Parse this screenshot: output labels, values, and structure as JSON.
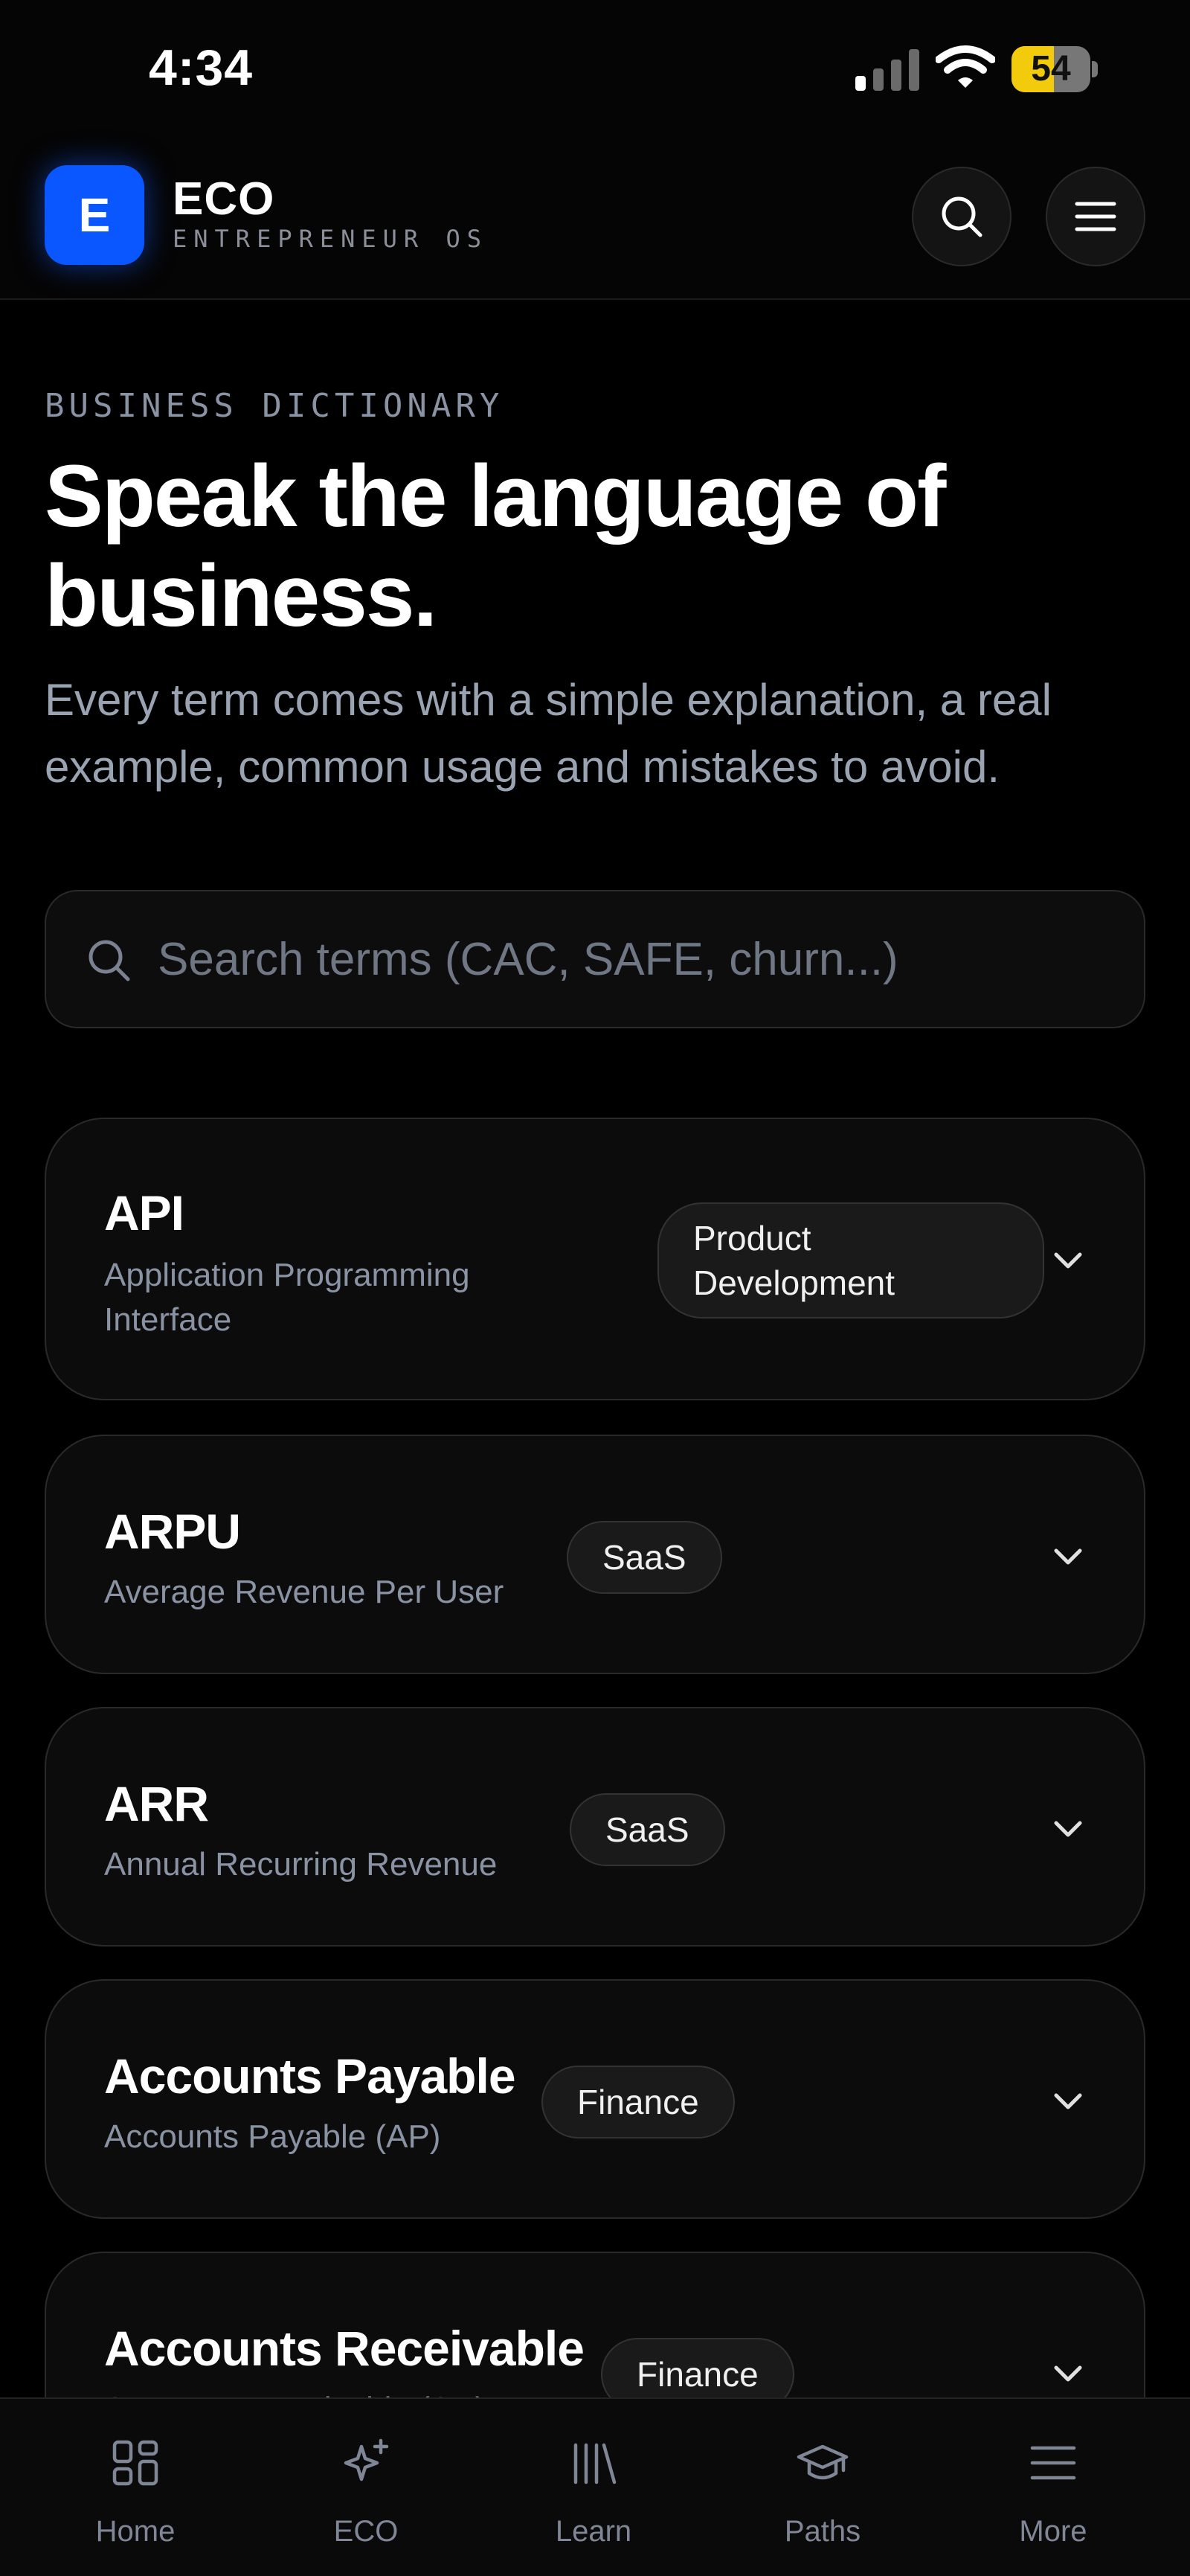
{
  "status": {
    "time": "4:34",
    "battery": 54
  },
  "header": {
    "logo_letter": "E",
    "brand": "ECO",
    "subtitle": "ENTREPRENEUR OS"
  },
  "hero": {
    "eyebrow": "BUSINESS DICTIONARY",
    "title_line1": "Speak the language of",
    "title_line2": "business.",
    "subtitle_line1": "Every term comes with a simple explanation, a real",
    "subtitle_line2": "example, common usage and mistakes to avoid."
  },
  "search": {
    "placeholder": "Search terms (CAC, SAFE, churn...)",
    "value": ""
  },
  "terms": [
    {
      "term": "API",
      "full_line1": "Application Programming",
      "full_line2": "Interface",
      "tag_line1": "Product",
      "tag_line2": "Development"
    },
    {
      "term": "ARPU",
      "full_line1": "Average Revenue Per User",
      "tag_line1": "SaaS"
    },
    {
      "term": "ARR",
      "full_line1": "Annual Recurring Revenue",
      "tag_line1": "SaaS"
    },
    {
      "term": "Accounts Payable",
      "full_line1": "Accounts Payable (AP)",
      "tag_line1": "Finance"
    },
    {
      "term": "Accounts Receivable",
      "full_line1": "Accounts Receivable (AR)",
      "tag_line1": "Finance"
    }
  ],
  "nav": [
    {
      "label": "Home",
      "icon": "home-grid-icon"
    },
    {
      "label": "ECO",
      "icon": "sparkle-icon"
    },
    {
      "label": "Learn",
      "icon": "library-icon"
    },
    {
      "label": "Paths",
      "icon": "graduation-cap-icon"
    },
    {
      "label": "More",
      "icon": "menu-icon"
    }
  ],
  "colors": {
    "accent": "#0b57ff",
    "battery": "#f2cc0c",
    "background": "#000000",
    "muted_text": "#8a93a3"
  }
}
